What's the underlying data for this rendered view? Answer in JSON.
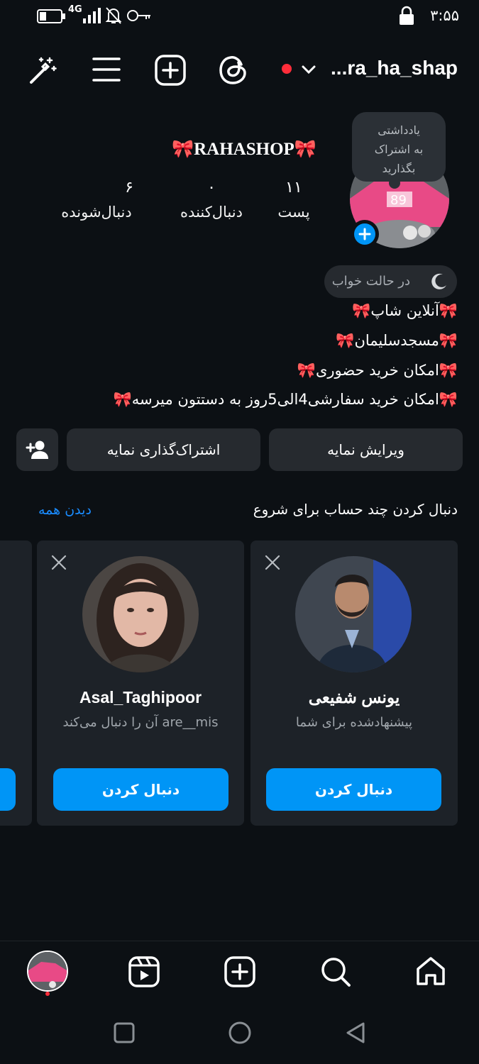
{
  "status_bar": {
    "time": "۳:۵۵",
    "network": "4G"
  },
  "header": {
    "username": "...ra_ha_shap"
  },
  "profile": {
    "name": "🎀RAHASHOP🎀",
    "note_bubble": [
      "یادداشتی",
      "به اشتراک",
      "بگذارید"
    ],
    "stats": [
      {
        "num": "۱۱",
        "label": "پست"
      },
      {
        "num": "۰",
        "label": "دنبال‌کننده"
      },
      {
        "num": "۶",
        "label": "دنبال‌شونده"
      }
    ],
    "status_chip": "در حالت خواب",
    "bio": [
      "🎀آنلاین شاپ🎀",
      "🎀مسجدسلیمان🎀",
      "🎀امکان خرید حضوری🎀",
      "🎀امکان خرید سفارشی4الی5روز به دستتون میرسه🎀"
    ]
  },
  "actions": {
    "edit": "ویرایش نمایه",
    "share": "اشتراک‌گذاری نمایه"
  },
  "suggestions": {
    "title": "دنبال کردن چند حساب برای شروع",
    "see_all": "دیدن همه",
    "cards": [
      {
        "name": "یونس شفیعی",
        "subtitle": "پیشنهادشده برای شما",
        "button": "دنبال کردن"
      },
      {
        "name": "Asal_Taghipoor",
        "subtitle": "are__mis آن را دنبال می‌کند",
        "button": "دنبال کردن"
      }
    ]
  },
  "colors": {
    "accent": "#0095f6",
    "background": "#0c1014",
    "live_dot": "#ff2d3a"
  }
}
